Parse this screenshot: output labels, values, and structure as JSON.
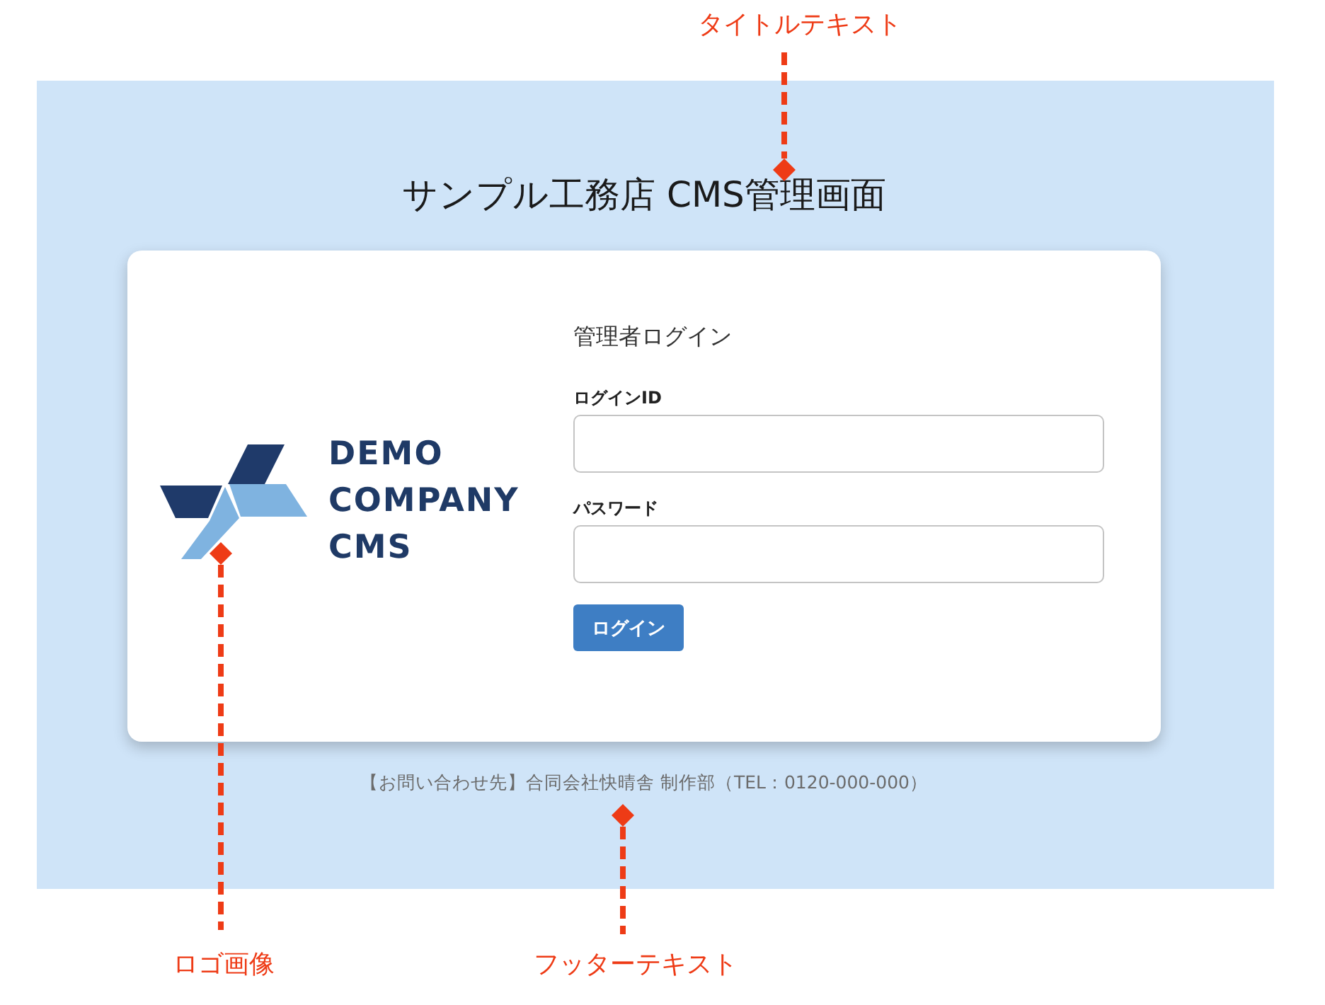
{
  "title": "サンプル工務店 CMS管理画面",
  "logo": {
    "lines": [
      "DEMO",
      "COMPANY",
      "CMS"
    ]
  },
  "login": {
    "heading": "管理者ログイン",
    "fields": [
      {
        "label": "ログインID"
      },
      {
        "label": "パスワード"
      }
    ],
    "button": "ログイン"
  },
  "footer": "【お問い合わせ先】合同会社快晴舎 制作部（TEL：0120-000-000）",
  "annotations": [
    {
      "kind": "title",
      "label": "タイトルテキスト"
    },
    {
      "kind": "logo",
      "label": "ロゴ画像"
    },
    {
      "kind": "footer",
      "label": "フッターテキスト"
    }
  ]
}
